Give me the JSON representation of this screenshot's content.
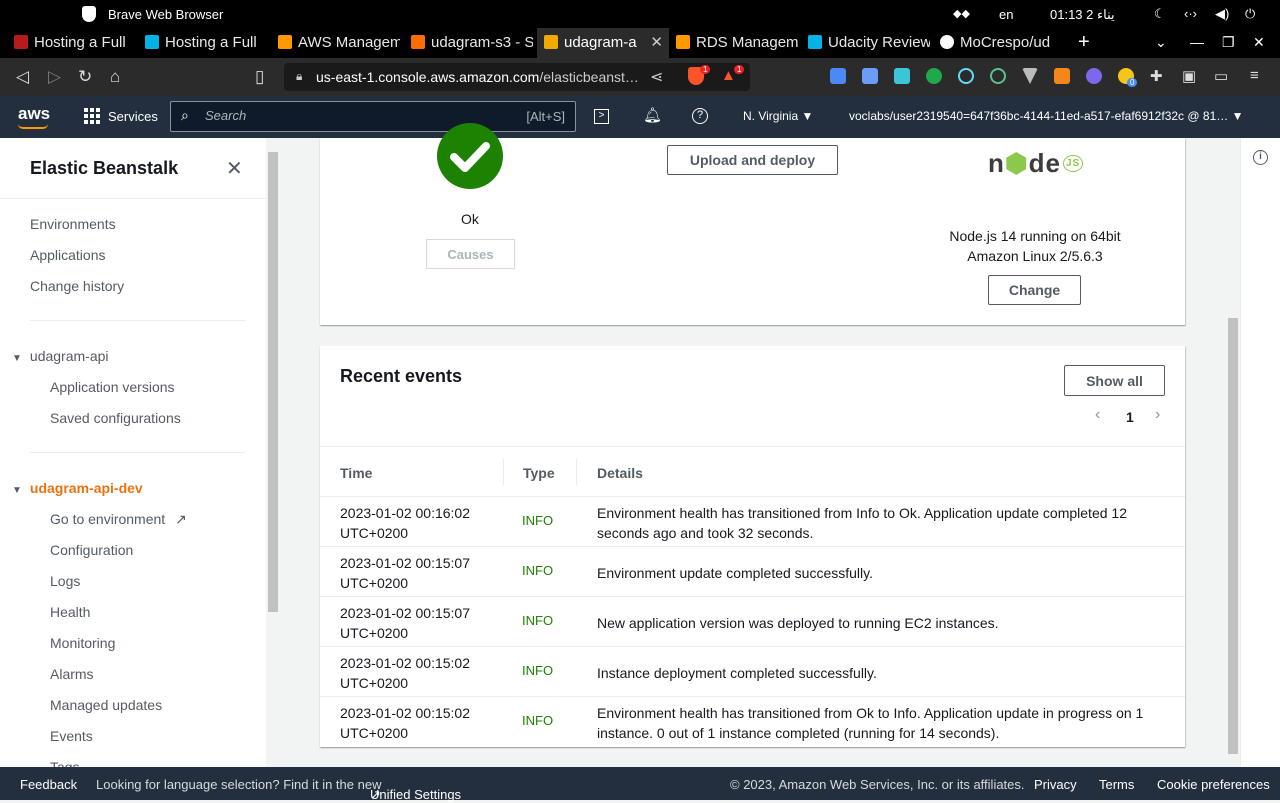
{
  "os": {
    "app_title": "Brave Web Browser",
    "lang": "en",
    "clock": "01:13 2 يناء"
  },
  "tabs": [
    {
      "label": "Hosting a Full",
      "color": "#b71c1c"
    },
    {
      "label": "Hosting a Full",
      "color": "#02b3e4"
    },
    {
      "label": "AWS Managem",
      "color": "#ff9900"
    },
    {
      "label": "udagram-s3 - S",
      "color": "#ff6d00"
    },
    {
      "label": "udagram-a",
      "color": "#f0ab00",
      "active": true
    },
    {
      "label": "RDS Managem",
      "color": "#ff9900"
    },
    {
      "label": "Udacity Review",
      "color": "#02b3e4"
    },
    {
      "label": "MoCrespo/ud",
      "color": "#ffffff"
    }
  ],
  "address": {
    "url_host": "us-east-1.console.aws.amazon.com",
    "url_path": "/elasticbeanst…",
    "shield_badge": "1",
    "alert_badge": "1",
    "ext_badge": "0"
  },
  "aws_nav": {
    "logo": "aws",
    "services_label": "Services",
    "search_placeholder": "Search",
    "search_shortcut": "[Alt+S]",
    "region": "N. Virginia ▼",
    "account": "voclabs/user2319540=647f36bc-4144-11ed-a517-efaf6912f32c @ 81… ▼"
  },
  "sidebar": {
    "title": "Elastic Beanstalk",
    "top_links": [
      "Environments",
      "Applications",
      "Change history"
    ],
    "app_section": "udagram-api",
    "app_links": [
      "Application versions",
      "Saved configurations"
    ],
    "env_section": "udagram-api-dev",
    "env_links": [
      "Go to environment",
      "Configuration",
      "Logs",
      "Health",
      "Monitoring",
      "Alarms",
      "Managed updates",
      "Events",
      "Tags"
    ]
  },
  "health": {
    "status": "Ok",
    "causes_label": "Causes"
  },
  "deploy": {
    "upload_label": "Upload and deploy"
  },
  "platform": {
    "line1": "Node.js 14 running on 64bit",
    "line2": "Amazon Linux 2/5.6.3",
    "change_label": "Change"
  },
  "events": {
    "title": "Recent events",
    "show_all": "Show all",
    "page": "1",
    "columns": {
      "time": "Time",
      "type": "Type",
      "details": "Details"
    },
    "rows": [
      {
        "date": "2023-01-02 00:16:02",
        "tz": "UTC+0200",
        "type": "INFO",
        "details": "Environment health has transitioned from Info to Ok. Application update completed 12 seconds ago and took 32 seconds."
      },
      {
        "date": "2023-01-02 00:15:07",
        "tz": "UTC+0200",
        "type": "INFO",
        "details": "Environment update completed successfully."
      },
      {
        "date": "2023-01-02 00:15:07",
        "tz": "UTC+0200",
        "type": "INFO",
        "details": "New application version was deployed to running EC2 instances."
      },
      {
        "date": "2023-01-02 00:15:02",
        "tz": "UTC+0200",
        "type": "INFO",
        "details": "Instance deployment completed successfully."
      },
      {
        "date": "2023-01-02 00:15:02",
        "tz": "UTC+0200",
        "type": "INFO",
        "details": "Environment health has transitioned from Ok to Info. Application update in progress on 1 instance. 0 out of 1 instance completed (running for 14 seconds)."
      }
    ]
  },
  "footer": {
    "feedback": "Feedback",
    "lang_notice": "Looking for language selection? Find it in the new",
    "unified": "Unified Settings",
    "copyright": "© 2023, Amazon Web Services, Inc. or its affiliates.",
    "privacy": "Privacy",
    "terms": "Terms",
    "cookies": "Cookie preferences"
  },
  "colors": {
    "aws_nav": "#232f3e",
    "accent": "#ec7211",
    "success": "#1d8102"
  }
}
